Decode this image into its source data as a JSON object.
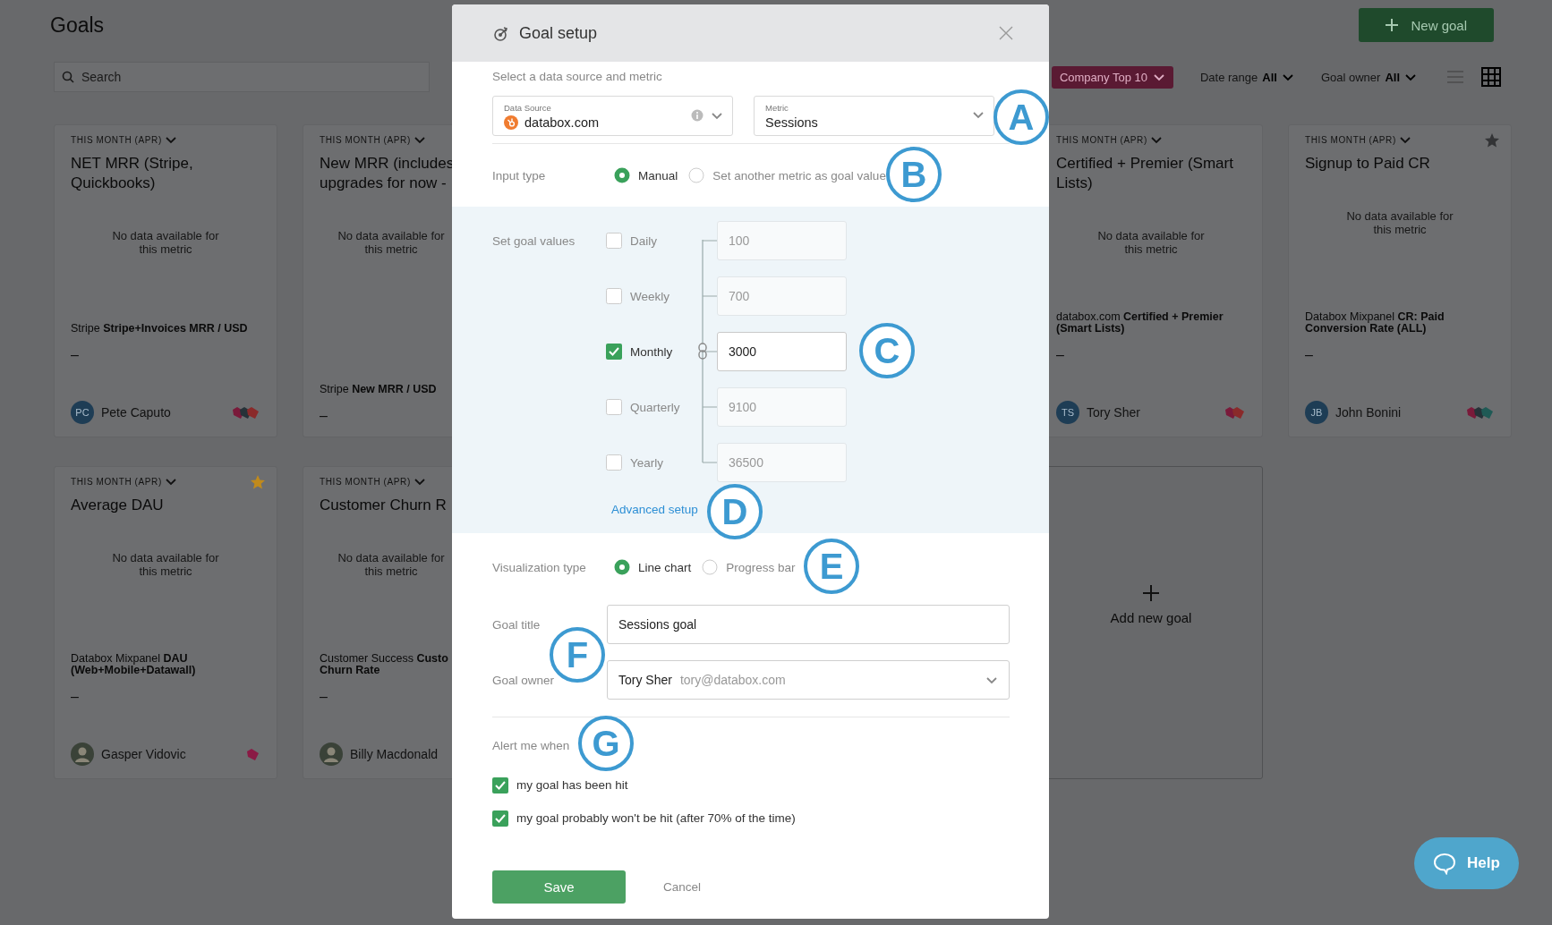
{
  "page": {
    "title": "Goals",
    "new_goal_button": "New goal"
  },
  "search": {
    "placeholder": "Search"
  },
  "filters": {
    "tag": "Company Top 10",
    "date_range": {
      "label": "Date range",
      "value": "All"
    },
    "goal_owner": {
      "label": "Goal owner",
      "value": "All"
    },
    "views": [
      {
        "kind": "list",
        "selected": false
      },
      {
        "kind": "grid",
        "selected": true
      }
    ]
  },
  "cards": [
    {
      "kind": "goal",
      "period": "THIS MONTH (APR)",
      "title": "NET MRR (Stripe, Quickbooks)",
      "empty_message": "No data available for this metric",
      "source_metric": "Stripe **Stripe+Invoices MRR / USD**",
      "value": "–",
      "owner": {
        "kind": "initials",
        "initials": "PC",
        "name": "Pete Caputo"
      },
      "tags": [
        {
          "color": "#7a1a3a"
        },
        {
          "color": "#263238"
        },
        {
          "color": "#8a2a2a"
        }
      ]
    },
    {
      "kind": "goal",
      "period": "THIS MONTH (APR)",
      "title": "New MRR (includes upgrades for now -",
      "empty_message": "No data available for this metric",
      "source_metric": "Stripe **New MRR / USD**",
      "value": "–"
    },
    {
      "kind": "goal",
      "period": "THIS MONTH (APR)",
      "title": "Certified + Premier (Smart Lists)",
      "empty_message": "No data available for this metric",
      "source_metric": "databox.com **Certified + Premier (Smart Lists)**",
      "value": "–",
      "owner": {
        "kind": "initials",
        "initials": "TS",
        "name": "Tory Sher"
      },
      "tags": [
        {
          "color": "#7a1a3a"
        },
        {
          "color": "#8a2a2a"
        }
      ]
    },
    {
      "kind": "goal",
      "period": "THIS MONTH (APR)",
      "title": "Signup to Paid CR",
      "starred": false,
      "empty_message": "No data available for this metric",
      "source_metric": "Databox Mixpanel **CR: Paid Conversion Rate (ALL)**",
      "value": "–",
      "owner": {
        "kind": "initials",
        "initials": "JB",
        "name": "John Bonini"
      },
      "tags": [
        {
          "color": "#7a1a3a"
        },
        {
          "color": "#263238"
        },
        {
          "color": "#1f5a55"
        }
      ]
    },
    {
      "kind": "goal",
      "period": "THIS MONTH (APR)",
      "title": "Average DAU",
      "starred": true,
      "empty_message": "No data available for this metric",
      "source_metric": "Databox Mixpanel **DAU (Web+Mobile+Datawall)**",
      "value": "–",
      "owner": {
        "kind": "photo",
        "name": "Gasper Vidovic"
      },
      "tags": [
        {
          "color": "#8a1a45"
        }
      ]
    },
    {
      "kind": "goal",
      "period": "THIS MONTH (APR)",
      "title": "Customer Churn R",
      "empty_message": "No data available for this metric",
      "source_metric": "Customer Success **Custo Churn Rate**",
      "value": "–",
      "owner": {
        "kind": "photo",
        "name": "Billy Macdonald"
      }
    },
    {
      "kind": "add",
      "label": "Add new goal"
    }
  ],
  "modal": {
    "title": "Goal setup",
    "hint": "Select a data source and metric",
    "data_source": {
      "label": "Data Source",
      "value": "databox.com"
    },
    "metric": {
      "label": "Metric",
      "value": "Sessions"
    },
    "input_type": {
      "label": "Input type",
      "options": [
        {
          "label": "Manual",
          "selected": true
        },
        {
          "label": "Set another metric as goal value",
          "selected": false
        }
      ]
    },
    "goal_values": {
      "label": "Set goal values",
      "rows": [
        {
          "label": "Daily",
          "checked": false,
          "value": "100"
        },
        {
          "label": "Weekly",
          "checked": false,
          "value": "700"
        },
        {
          "label": "Monthly",
          "checked": true,
          "value": "3000"
        },
        {
          "label": "Quarterly",
          "checked": false,
          "value": "9100"
        },
        {
          "label": "Yearly",
          "checked": false,
          "value": "36500"
        }
      ],
      "advanced_link": "Advanced setup"
    },
    "visualization": {
      "label": "Visualization type",
      "options": [
        {
          "label": "Line chart",
          "selected": true
        },
        {
          "label": "Progress bar",
          "selected": false
        }
      ]
    },
    "goal_title": {
      "label": "Goal title",
      "value": "Sessions goal"
    },
    "goal_owner": {
      "label": "Goal owner",
      "name": "Tory Sher",
      "email": "tory@databox.com"
    },
    "alerts": {
      "label": "Alert me when",
      "items": [
        {
          "label": "my goal has been hit",
          "checked": true
        },
        {
          "label": "my goal probably won't be hit (after 70% of the time)",
          "checked": true
        }
      ]
    },
    "save_button": "Save",
    "cancel_button": "Cancel"
  },
  "callouts": [
    {
      "letter": "A"
    },
    {
      "letter": "B"
    },
    {
      "letter": "C"
    },
    {
      "letter": "D"
    },
    {
      "letter": "E"
    },
    {
      "letter": "F"
    },
    {
      "letter": "G"
    }
  ],
  "help_button": "Help"
}
